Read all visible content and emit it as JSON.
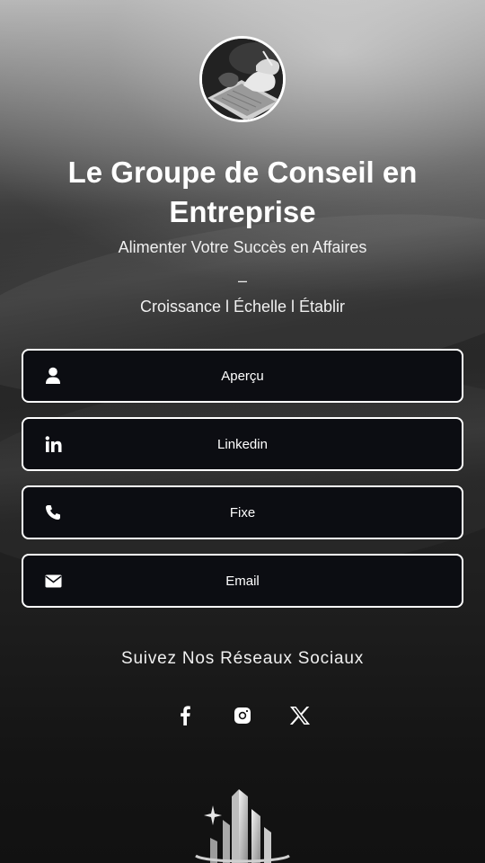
{
  "profile": {
    "title": "Le Groupe de Conseil en Entreprise",
    "subtitle": "Alimenter Votre Succès en Affaires",
    "dash": "–",
    "tagline": "Croissance l Échelle l Établir"
  },
  "links": [
    {
      "label": "Aperçu",
      "icon": "user-icon"
    },
    {
      "label": "Linkedin",
      "icon": "linkedin-icon"
    },
    {
      "label": "Fixe",
      "icon": "phone-icon"
    },
    {
      "label": "Email",
      "icon": "envelope-icon"
    }
  ],
  "social": {
    "heading": "Suivez Nos Réseaux Sociaux",
    "icons": [
      "facebook-icon",
      "instagram-icon",
      "x-icon"
    ]
  },
  "colors": {
    "button_bg": "#0c0d12",
    "button_border": "#ffffff",
    "text": "#ffffff"
  }
}
